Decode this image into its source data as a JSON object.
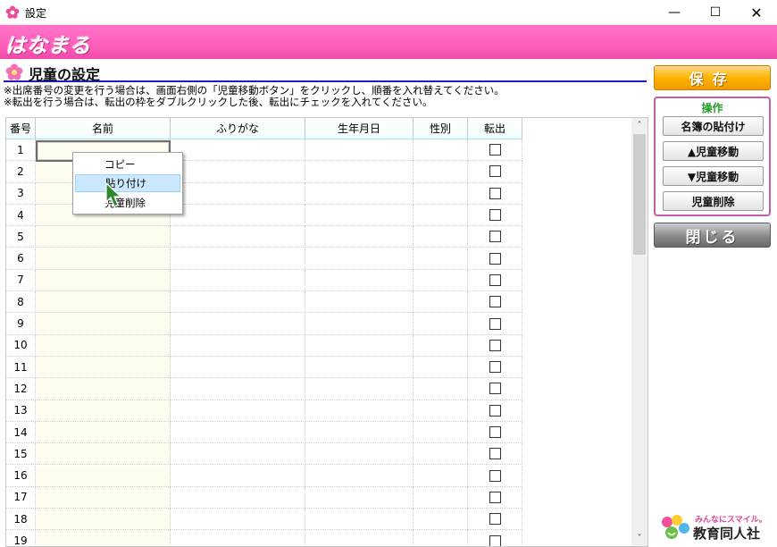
{
  "window": {
    "title": "設定",
    "minimize_glyph": "—",
    "maximize_glyph": "☐",
    "close_glyph": "✕"
  },
  "banner": {
    "logo_text": "はなまる"
  },
  "section": {
    "title": "児童の設定",
    "notes": [
      "※出席番号の変更を行う場合は、画面右側の「児童移動ボタン」をクリックし、順番を入れ替えてください。",
      "※転出を行う場合は、転出の枠をダブルクリックした後、転出にチェックを入れてください。"
    ]
  },
  "grid": {
    "columns": [
      "番号",
      "名前",
      "ふりがな",
      "生年月日",
      "性別",
      "転出"
    ],
    "row_numbers": [
      "1",
      "2",
      "3",
      "4",
      "5",
      "6",
      "7",
      "8",
      "9",
      "10",
      "11",
      "12",
      "13",
      "14",
      "15",
      "16",
      "17",
      "18",
      "19"
    ],
    "scroll_up": "˄",
    "scroll_down": "˅"
  },
  "context_menu": {
    "items": [
      "コピー",
      "貼り付け",
      "児童削除"
    ],
    "highlighted": "貼り付け"
  },
  "actions": {
    "save": "保存",
    "ops_label": "操作",
    "paste_roster": "名簿の貼付け",
    "move_up": "▲児童移動",
    "move_down": "▼児童移動",
    "delete_child": "児童削除",
    "close": "閉じる"
  },
  "brand": {
    "tagline": "みんなにスマイル。",
    "company": "教育同人社"
  },
  "colors": {
    "banner_pink": "#ff5fbb",
    "save_orange": "#ffb400",
    "ops_border": "#c05fa8",
    "ops_label_green": "#22a02a",
    "heading_rule_blue": "#1c1cc8"
  }
}
